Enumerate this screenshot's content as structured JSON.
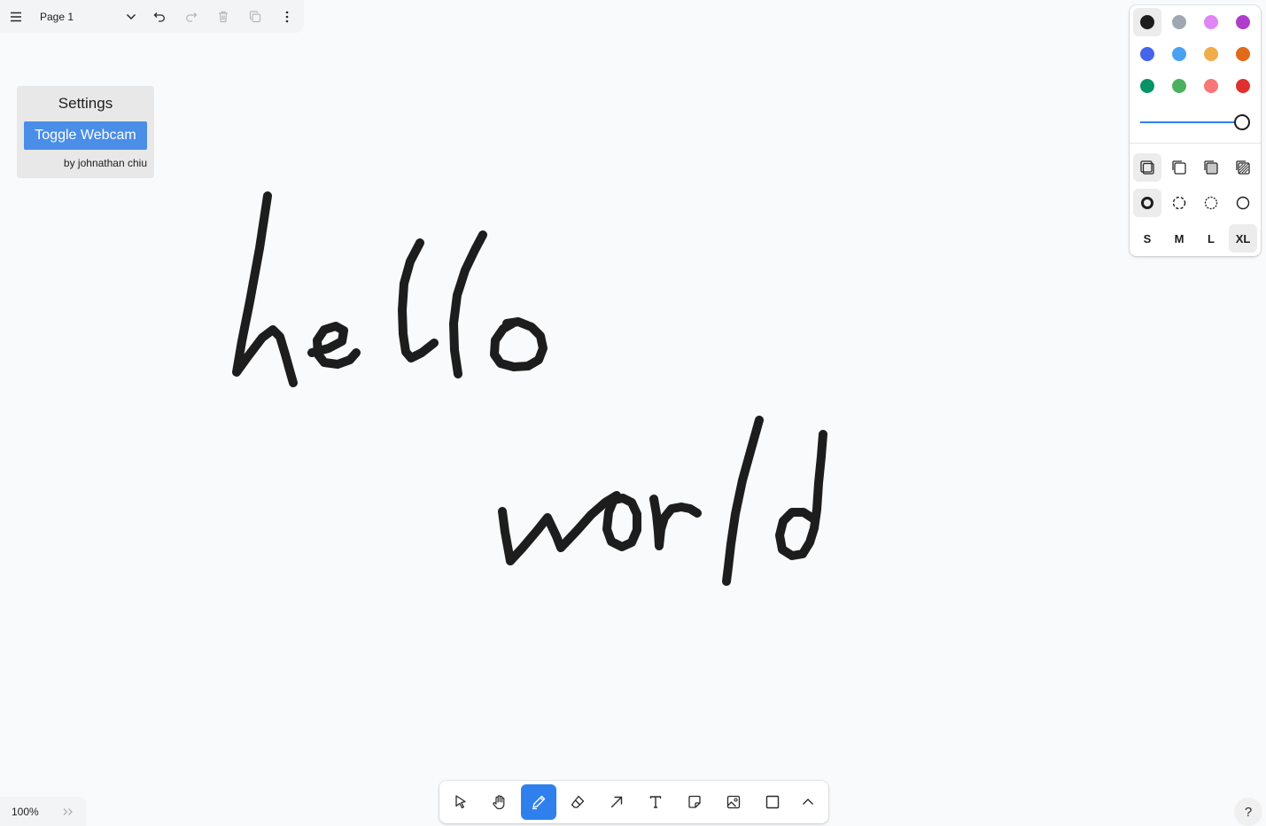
{
  "menu_bar": {
    "page_name": "Page 1",
    "icons": [
      "hamburger-menu-icon",
      "chevron-down-icon",
      "undo-icon",
      "redo-icon",
      "trash-icon",
      "duplicate-icon",
      "more-vertical-icon"
    ]
  },
  "settings": {
    "title": "Settings",
    "webcam_button": "Toggle Webcam",
    "credit": "by johnathan chiu"
  },
  "canvas": {
    "stroke_color": "#1d1d1d"
  },
  "style_panel": {
    "colors": [
      {
        "name": "black",
        "hex": "#1d1d1d",
        "selected": true
      },
      {
        "name": "grey",
        "hex": "#9fa8b2",
        "selected": false
      },
      {
        "name": "light-violet",
        "hex": "#e085f4",
        "selected": false
      },
      {
        "name": "violet",
        "hex": "#ae3ec9",
        "selected": false
      },
      {
        "name": "blue",
        "hex": "#4465e9",
        "selected": false
      },
      {
        "name": "light-blue",
        "hex": "#4ba1f1",
        "selected": false
      },
      {
        "name": "yellow",
        "hex": "#f1ac4b",
        "selected": false
      },
      {
        "name": "orange",
        "hex": "#e16919",
        "selected": false
      },
      {
        "name": "green",
        "hex": "#099268",
        "selected": false
      },
      {
        "name": "light-green",
        "hex": "#4cb05e",
        "selected": false
      },
      {
        "name": "light-red",
        "hex": "#f87777",
        "selected": false
      },
      {
        "name": "red",
        "hex": "#e03131",
        "selected": false
      }
    ],
    "opacity": 1.0,
    "fill_options": [
      "fill-none-icon",
      "fill-semi-icon",
      "fill-solid-icon",
      "fill-pattern-icon"
    ],
    "fill_selected": "fill-none-icon",
    "dash_options": [
      "dash-draw-icon",
      "dash-dashed-icon",
      "dash-dotted-icon",
      "dash-solid-icon"
    ],
    "dash_selected": "dash-draw-icon",
    "sizes": [
      "S",
      "M",
      "L",
      "XL"
    ],
    "size_selected": "XL"
  },
  "toolbar": {
    "tools": [
      "select-tool-icon",
      "hand-tool-icon",
      "draw-tool-icon",
      "eraser-tool-icon",
      "arrow-tool-icon",
      "text-tool-icon",
      "note-tool-icon",
      "image-tool-icon",
      "rectangle-tool-icon",
      "more-tools-chevron-up-icon"
    ],
    "active_tool": "draw-tool-icon",
    "accent_color": "#2f80ed"
  },
  "zoom": {
    "label": "100%"
  },
  "help": {
    "label": "?"
  }
}
